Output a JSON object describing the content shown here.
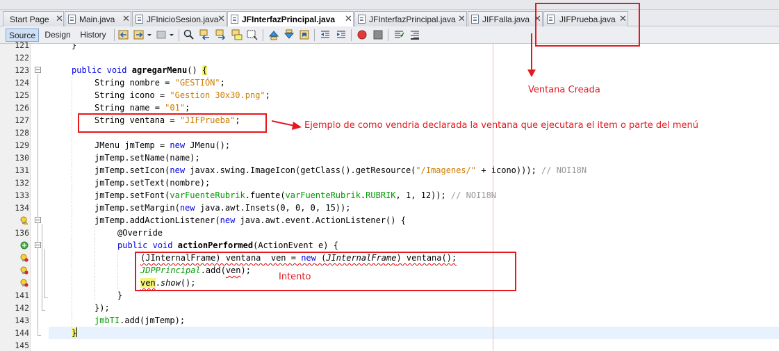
{
  "tabs": [
    {
      "label": "Start Page",
      "active": false,
      "icon": "none"
    },
    {
      "label": "Main.java",
      "active": false,
      "icon": "java-file-icon"
    },
    {
      "label": "JFInicioSesion.java",
      "active": false,
      "icon": "java-file-icon"
    },
    {
      "label": "JFInterfazPrincipal.java",
      "active": true,
      "icon": "java-file-icon"
    },
    {
      "label": "JFInterfazPrincipal.java",
      "active": false,
      "icon": "java-file-icon"
    },
    {
      "label": "JIFFalla.java",
      "active": false,
      "icon": "java-file-icon"
    },
    {
      "label": "JIFPrueba.java",
      "active": false,
      "icon": "java-file-icon"
    }
  ],
  "tab_close_glyph": "✕",
  "view_tabs": {
    "source": "Source",
    "design": "Design",
    "history": "History"
  },
  "toolbar_icons": [
    "back-icon",
    "forward-icon",
    "last-edit-icon",
    "find-selection-icon",
    "find-previous-icon",
    "find-next-icon",
    "toggle-highlight-icon",
    "toggle-rectangular-selection-icon",
    "previous-bookmark-icon",
    "next-bookmark-icon",
    "toggle-bookmark-icon",
    "shift-left-icon",
    "shift-right-icon",
    "start-macro-icon",
    "stop-macro-icon",
    "comment-icon",
    "uncomment-icon"
  ],
  "line_numbers": [
    "121",
    "122",
    "123",
    "124",
    "125",
    "126",
    "127",
    "128",
    "129",
    "130",
    "131",
    "132",
    "133",
    "134",
    "",
    "136",
    "",
    "",
    "",
    "",
    "141",
    "142",
    "143",
    "144",
    "145"
  ],
  "code": {
    "l121": "}",
    "l123": {
      "kw1": "public",
      "kw2": "void",
      "name": "agregarMenu",
      "rest": "() ",
      "brace": "{"
    },
    "l124": {
      "type": "String nombre = ",
      "str": "\"GESTIÓN\"",
      "end": ";"
    },
    "l125": {
      "type": "String icono = ",
      "str": "\"Gestion 30x30.png\"",
      "end": ";"
    },
    "l126": {
      "type": "String name = ",
      "str": "\"01\"",
      "end": ";"
    },
    "l127": {
      "type": "String ventana = ",
      "str": "\"JIFPrueba\"",
      "end": ";"
    },
    "l129": {
      "a": "JMenu jmTemp = ",
      "kw": "new",
      "b": " JMenu();"
    },
    "l130": "jmTemp.setName(name);",
    "l131": {
      "a": "jmTemp.setIcon(",
      "kw": "new",
      "b": " javax.swing.ImageIcon(getClass().getResource(",
      "str": "\"/Imagenes/\"",
      "c": " + icono))); ",
      "comment": "// NOI18N"
    },
    "l132": "jmTemp.setText(nombre);",
    "l133": {
      "a": "jmTemp.setFont(",
      "f1": "varFuenteRubrik",
      "b": ".fuente(",
      "f2": "varFuenteRubrik",
      "c": ".",
      "f3": "RUBRIK",
      "d": ", 1, 12)); ",
      "comment": "// NOI18N"
    },
    "l134": {
      "a": "jmTemp.setMargin(",
      "kw": "new",
      "b": " java.awt.Insets(0, 0, 0, 15));"
    },
    "l135": {
      "a": "jmTemp.addActionListener(",
      "kw": "new",
      "b": " java.awt.event.ActionListener() {"
    },
    "l136": "@Override",
    "l137": {
      "kw1": "public",
      "kw2": "void",
      "name": "actionPerformed",
      "rest": "(ActionEvent e) {"
    },
    "l138": {
      "a": "(JInternalFrame) ventana  ven = ",
      "kw": "new",
      "b": " (",
      "it1": "JInternalFrame",
      "c": ") ventana();"
    },
    "l139": {
      "cls": "JDPPrincipal",
      "a": ".add(",
      "v": "ven",
      "b": ");"
    },
    "l140": {
      "v": "ven",
      "a": ".",
      "m": "show",
      "b": "();"
    },
    "l141": "}",
    "l142": "});",
    "l143": {
      "f": "jmbTI",
      "a": ".add(jmTemp);"
    },
    "l144": "}"
  },
  "annotations": {
    "ventana_creada": "Ventana Creada",
    "ejemplo": "Ejemplo de como vendria declarada la ventana que ejecutara el item o parte del menú",
    "intento": "Intento"
  },
  "colors": {
    "annotation": "#e5181d",
    "keyword": "#0000e6",
    "string": "#ce7b00",
    "field": "#009900",
    "comment": "#969696",
    "highlight": "#f3f37a",
    "current_line": "#e8f2fe"
  }
}
